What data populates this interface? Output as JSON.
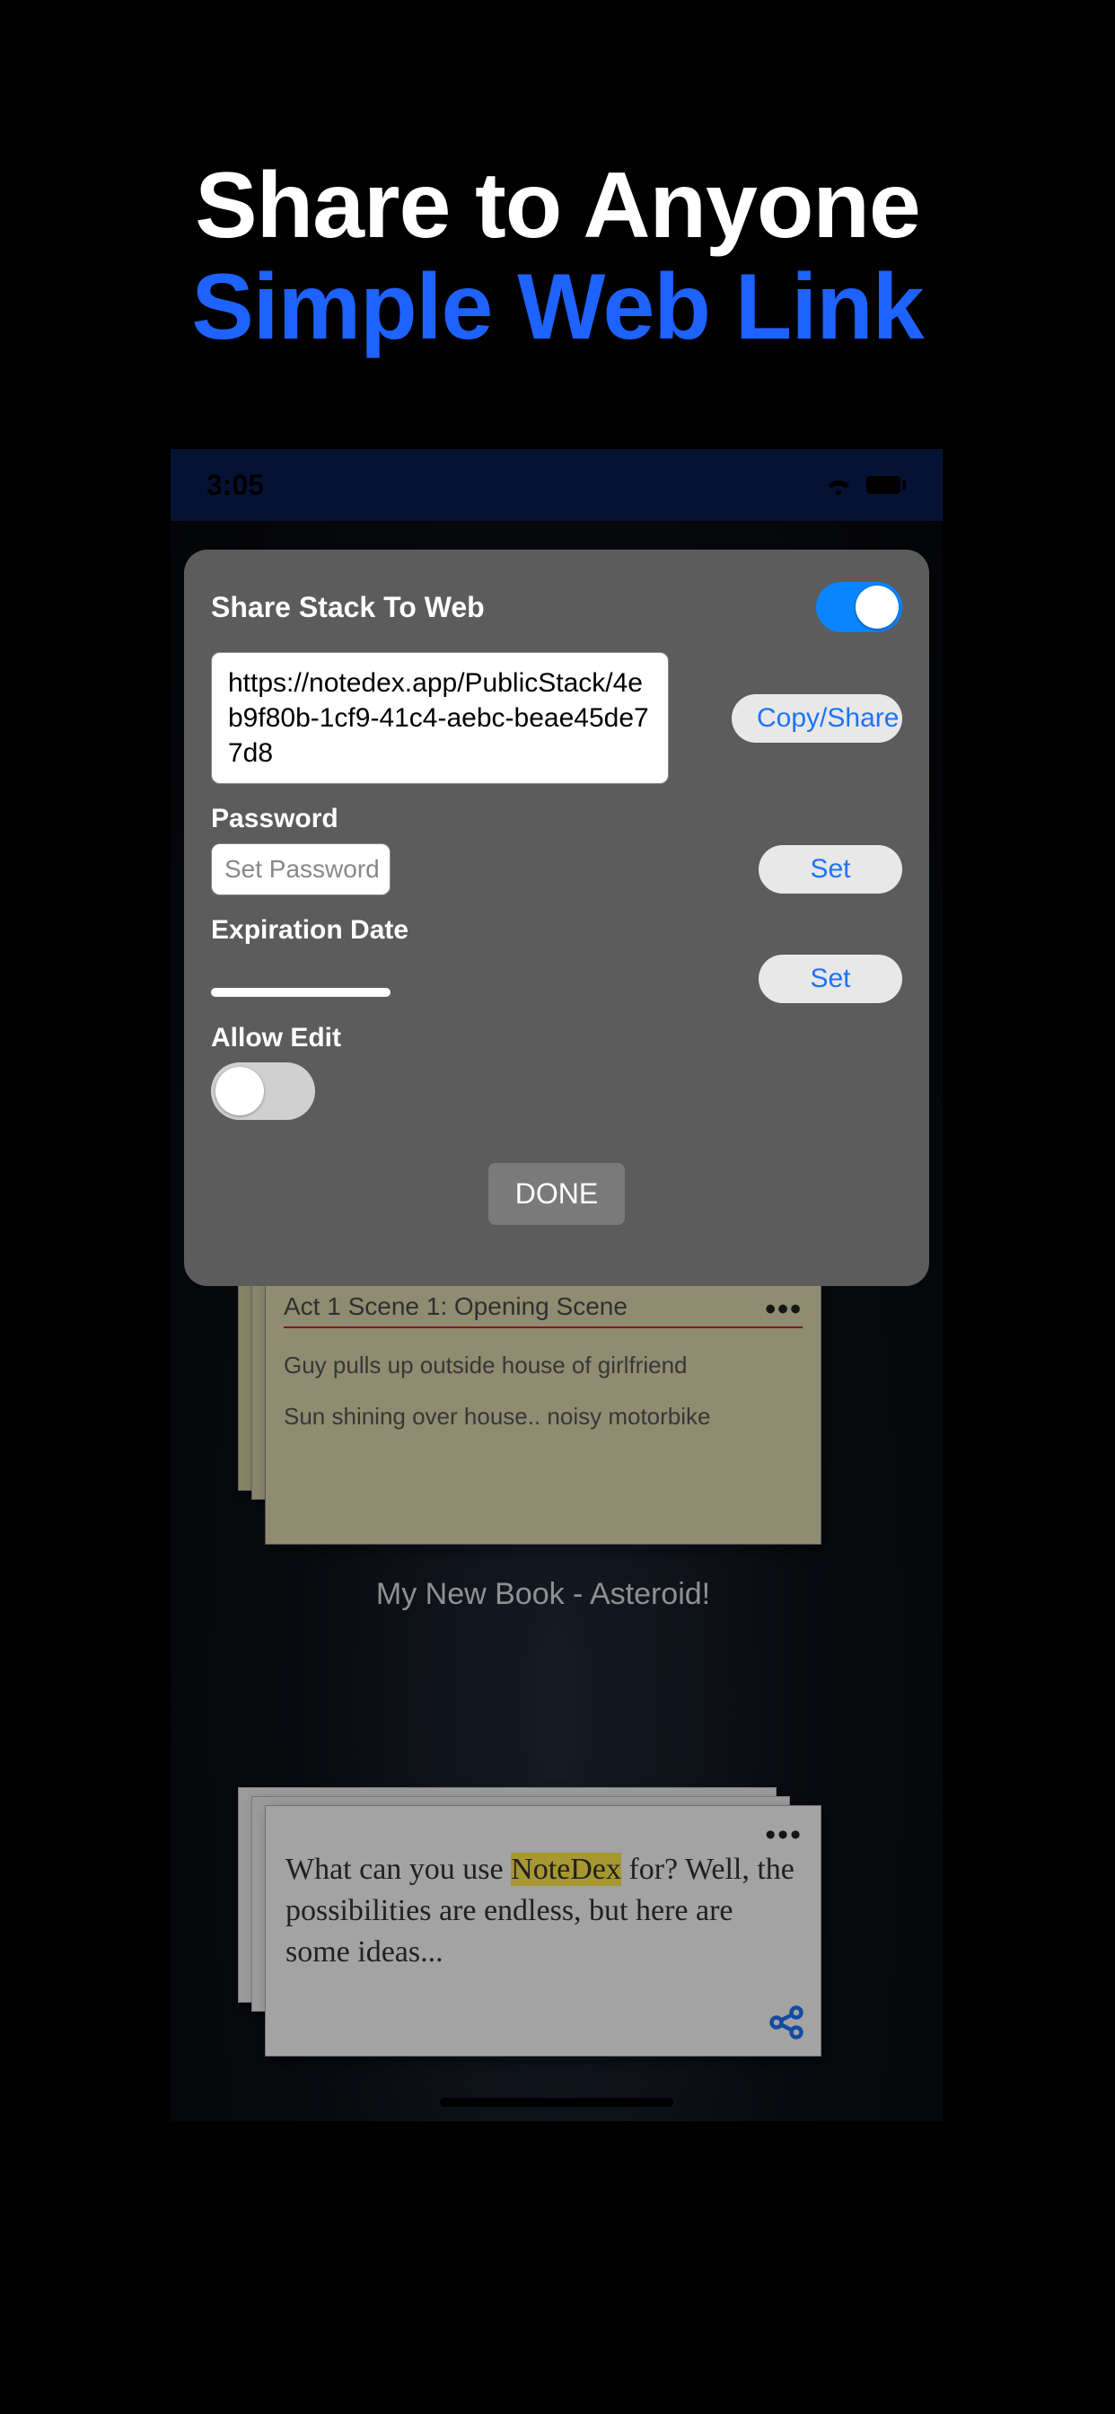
{
  "promo": {
    "line1": "Share to Anyone",
    "line2": "Simple Web Link"
  },
  "statusbar": {
    "time": "3:05"
  },
  "modal": {
    "title": "Share Stack To Web",
    "share_enabled": true,
    "url": "https://notedex.app/PublicStack/4eb9f80b-1cf9-41c4-aebc-beae45de77d8",
    "copy_share_label": "Copy/Share",
    "password_label": "Password",
    "password_placeholder": "Set Password",
    "password_set_label": "Set",
    "expiration_label": "Expiration Date",
    "expiration_set_label": "Set",
    "allow_edit_label": "Allow Edit",
    "allow_edit_enabled": false,
    "done_label": "DONE"
  },
  "stacks": [
    {
      "card_title": "Act 1 Scene 1: Opening Scene",
      "lines": [
        "Guy pulls up outside house of girlfriend",
        "Sun shining over house.. noisy motorbike"
      ],
      "label": "My New Book - Asteroid!"
    },
    {
      "text_prefix": "What can you use ",
      "text_highlight": "NoteDex",
      "text_suffix": " for? Well, the possibilities are endless, but here are some ideas..."
    }
  ]
}
